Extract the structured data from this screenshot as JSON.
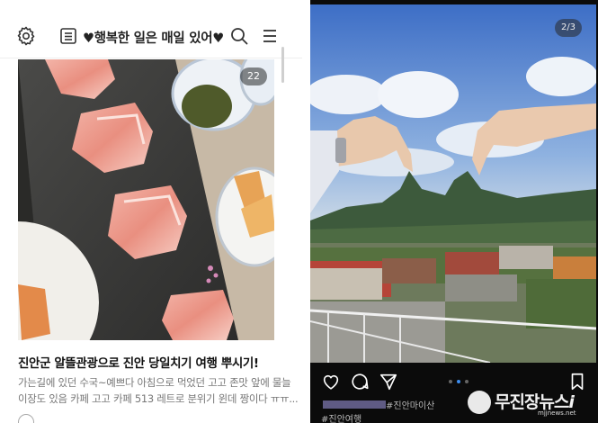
{
  "blog": {
    "title": "♥행복한 일은 매일 있어♥",
    "photo_count": "22",
    "post_title": "진안군 알뜰관광으로 진안 당일치기 여행 뿌시기!",
    "excerpt_line1": "가는길에 있던 수국~예쁘다 아침으로 먹었던 고고 존맛 앞에 물늘",
    "excerpt_line2": "이장도 있음 카페 고고 카페 513 레트로 분위기 윈데 짱이다 ㅠㅠ..."
  },
  "instagram": {
    "page_indicator": "2/3",
    "hashtag_line1": "#진안마이산",
    "hashtag_line2": "#진안여행"
  },
  "watermark": {
    "name": "무진장뉴스",
    "suffix": "i",
    "url": "mjjnews.net"
  },
  "icons": [
    "gear-icon",
    "list-icon",
    "search-icon",
    "menu-icon",
    "heart-icon",
    "comment-icon",
    "send-icon",
    "bookmark-icon"
  ]
}
